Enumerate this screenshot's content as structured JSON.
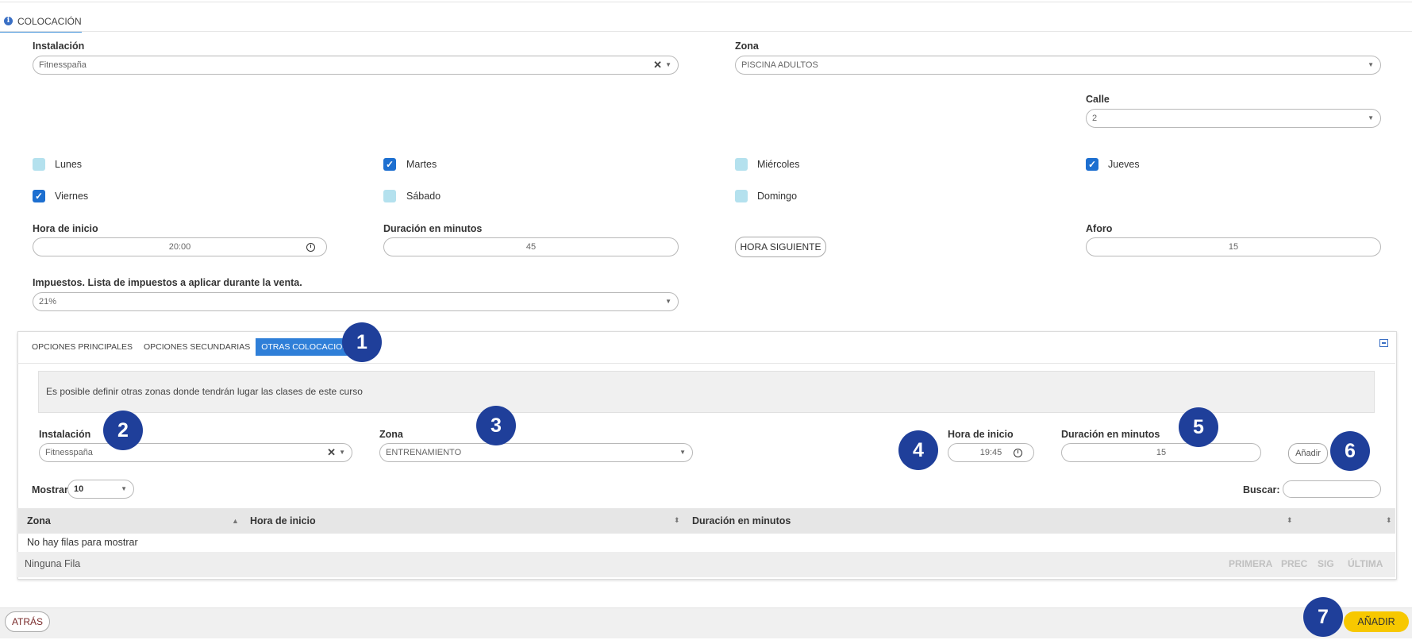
{
  "colors": {
    "accent": "#2f7fd8",
    "checkbox_on": "#1d6fd0",
    "checkbox_off": "#b4e1ee",
    "marker": "#1f3f9a",
    "primary_button": "#f7c800"
  },
  "header": {
    "tab_label": "COLOCACIÓN",
    "info_icon": "info-icon"
  },
  "form": {
    "instalacion": {
      "label": "Instalación",
      "value": "Fitnesspaña"
    },
    "zona": {
      "label": "Zona",
      "value": "PISCINA ADULTOS"
    },
    "calle": {
      "label": "Calle",
      "value": "2"
    },
    "days": [
      {
        "label": "Lunes",
        "checked": false
      },
      {
        "label": "Martes",
        "checked": true
      },
      {
        "label": "Miércoles",
        "checked": false
      },
      {
        "label": "Jueves",
        "checked": true
      },
      {
        "label": "Viernes",
        "checked": true
      },
      {
        "label": "Sábado",
        "checked": false
      },
      {
        "label": "Domingo",
        "checked": false
      }
    ],
    "hora_inicio": {
      "label": "Hora de inicio",
      "value": "20:00"
    },
    "duracion": {
      "label": "Duración en minutos",
      "value": "45"
    },
    "hora_siguiente_button": "HORA SIGUIENTE",
    "aforo": {
      "label": "Aforo",
      "value": "15"
    },
    "impuestos": {
      "label": "Impuestos. Lista de impuestos a aplicar durante la venta.",
      "value": "21%"
    }
  },
  "panel": {
    "tabs": [
      "OPCIONES PRINCIPALES",
      "OPCIONES SECUNDARIAS",
      "OTRAS COLOCACIONES"
    ],
    "active_tab": "OTRAS COLOCACIONES",
    "info_text": "Es posible definir otras zonas donde tendrán lugar las clases de este curso",
    "instalacion": {
      "label": "Instalación",
      "value": "Fitnesspaña"
    },
    "zona": {
      "label": "Zona",
      "value": "ENTRENAMIENTO"
    },
    "hora_inicio": {
      "label": "Hora de inicio",
      "value": "19:45"
    },
    "duracion": {
      "label": "Duración en minutos",
      "value": "15"
    },
    "add_button": "Añadir",
    "mostrar_label": "Mostrar",
    "mostrar_value": "10",
    "buscar_label": "Buscar:",
    "buscar_value": "",
    "table": {
      "columns": [
        "Zona",
        "Hora de inicio",
        "Duración en minutos",
        ""
      ],
      "empty_text": "No hay filas para mostrar",
      "footer_text": "Ninguna Fila",
      "pagination": [
        "PRIMERA",
        "PREC",
        "SIG",
        "ÚLTIMA"
      ]
    }
  },
  "markers": [
    "1",
    "2",
    "3",
    "4",
    "5",
    "6",
    "7"
  ],
  "footer": {
    "back_button": "ATRÁS",
    "add_button": "AÑADIR"
  }
}
